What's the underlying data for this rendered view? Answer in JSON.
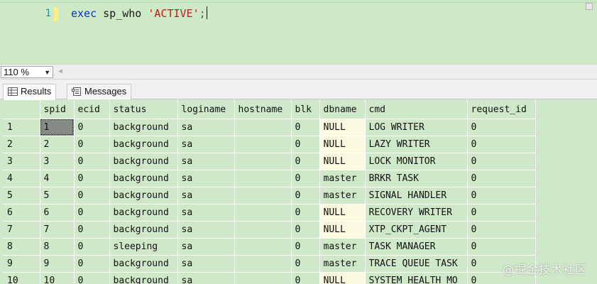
{
  "editor": {
    "line_number": "1",
    "code": {
      "keyword": "exec",
      "procedure": "sp_who",
      "argument": "'ACTIVE'",
      "terminator": ";"
    }
  },
  "zoom": {
    "value": "110 %"
  },
  "tabs": [
    {
      "label": "Results",
      "icon": "grid-icon",
      "active": true
    },
    {
      "label": "Messages",
      "icon": "messages-icon",
      "active": false
    }
  ],
  "grid": {
    "columns": [
      "spid",
      "ecid",
      "status",
      "loginame",
      "hostname",
      "blk",
      "dbname",
      "cmd",
      "request_id"
    ],
    "rows": [
      {
        "n": "1",
        "spid": "1",
        "ecid": "0",
        "status": "background",
        "loginame": "sa",
        "hostname": "",
        "blk": "0",
        "dbname": "NULL",
        "cmd": "LOG WRITER",
        "request_id": "0"
      },
      {
        "n": "2",
        "spid": "2",
        "ecid": "0",
        "status": "background",
        "loginame": "sa",
        "hostname": "",
        "blk": "0",
        "dbname": "NULL",
        "cmd": "LAZY WRITER",
        "request_id": "0"
      },
      {
        "n": "3",
        "spid": "3",
        "ecid": "0",
        "status": "background",
        "loginame": "sa",
        "hostname": "",
        "blk": "0",
        "dbname": "NULL",
        "cmd": "LOCK MONITOR",
        "request_id": "0"
      },
      {
        "n": "4",
        "spid": "4",
        "ecid": "0",
        "status": "background",
        "loginame": "sa",
        "hostname": "",
        "blk": "0",
        "dbname": "master",
        "cmd": "BRKR TASK",
        "request_id": "0"
      },
      {
        "n": "5",
        "spid": "5",
        "ecid": "0",
        "status": "background",
        "loginame": "sa",
        "hostname": "",
        "blk": "0",
        "dbname": "master",
        "cmd": "SIGNAL HANDLER",
        "request_id": "0"
      },
      {
        "n": "6",
        "spid": "6",
        "ecid": "0",
        "status": "background",
        "loginame": "sa",
        "hostname": "",
        "blk": "0",
        "dbname": "NULL",
        "cmd": "RECOVERY WRITER",
        "request_id": "0"
      },
      {
        "n": "7",
        "spid": "7",
        "ecid": "0",
        "status": "background",
        "loginame": "sa",
        "hostname": "",
        "blk": "0",
        "dbname": "NULL",
        "cmd": "XTP_CKPT_AGENT",
        "request_id": "0"
      },
      {
        "n": "8",
        "spid": "8",
        "ecid": "0",
        "status": "sleeping",
        "loginame": "sa",
        "hostname": "",
        "blk": "0",
        "dbname": "master",
        "cmd": "TASK MANAGER",
        "request_id": "0"
      },
      {
        "n": "9",
        "spid": "9",
        "ecid": "0",
        "status": "background",
        "loginame": "sa",
        "hostname": "",
        "blk": "0",
        "dbname": "master",
        "cmd": "TRACE QUEUE TASK",
        "request_id": "0"
      },
      {
        "n": "10",
        "spid": "10",
        "ecid": "0",
        "status": "background",
        "loginame": "sa",
        "hostname": "",
        "blk": "0",
        "dbname": "NULL",
        "cmd": "SYSTEM_HEALTH_MO",
        "request_id": "0"
      }
    ]
  },
  "watermark": "@掘金技术社区",
  "colors": {
    "editor_bg": "#cde9c6",
    "grid_bg": "#cfe9c8",
    "keyword": "#0a33d1",
    "string": "#c21b1b",
    "line_number": "#2b91af",
    "selected_cell": "#838b83",
    "null_cell": "#fafae0"
  }
}
